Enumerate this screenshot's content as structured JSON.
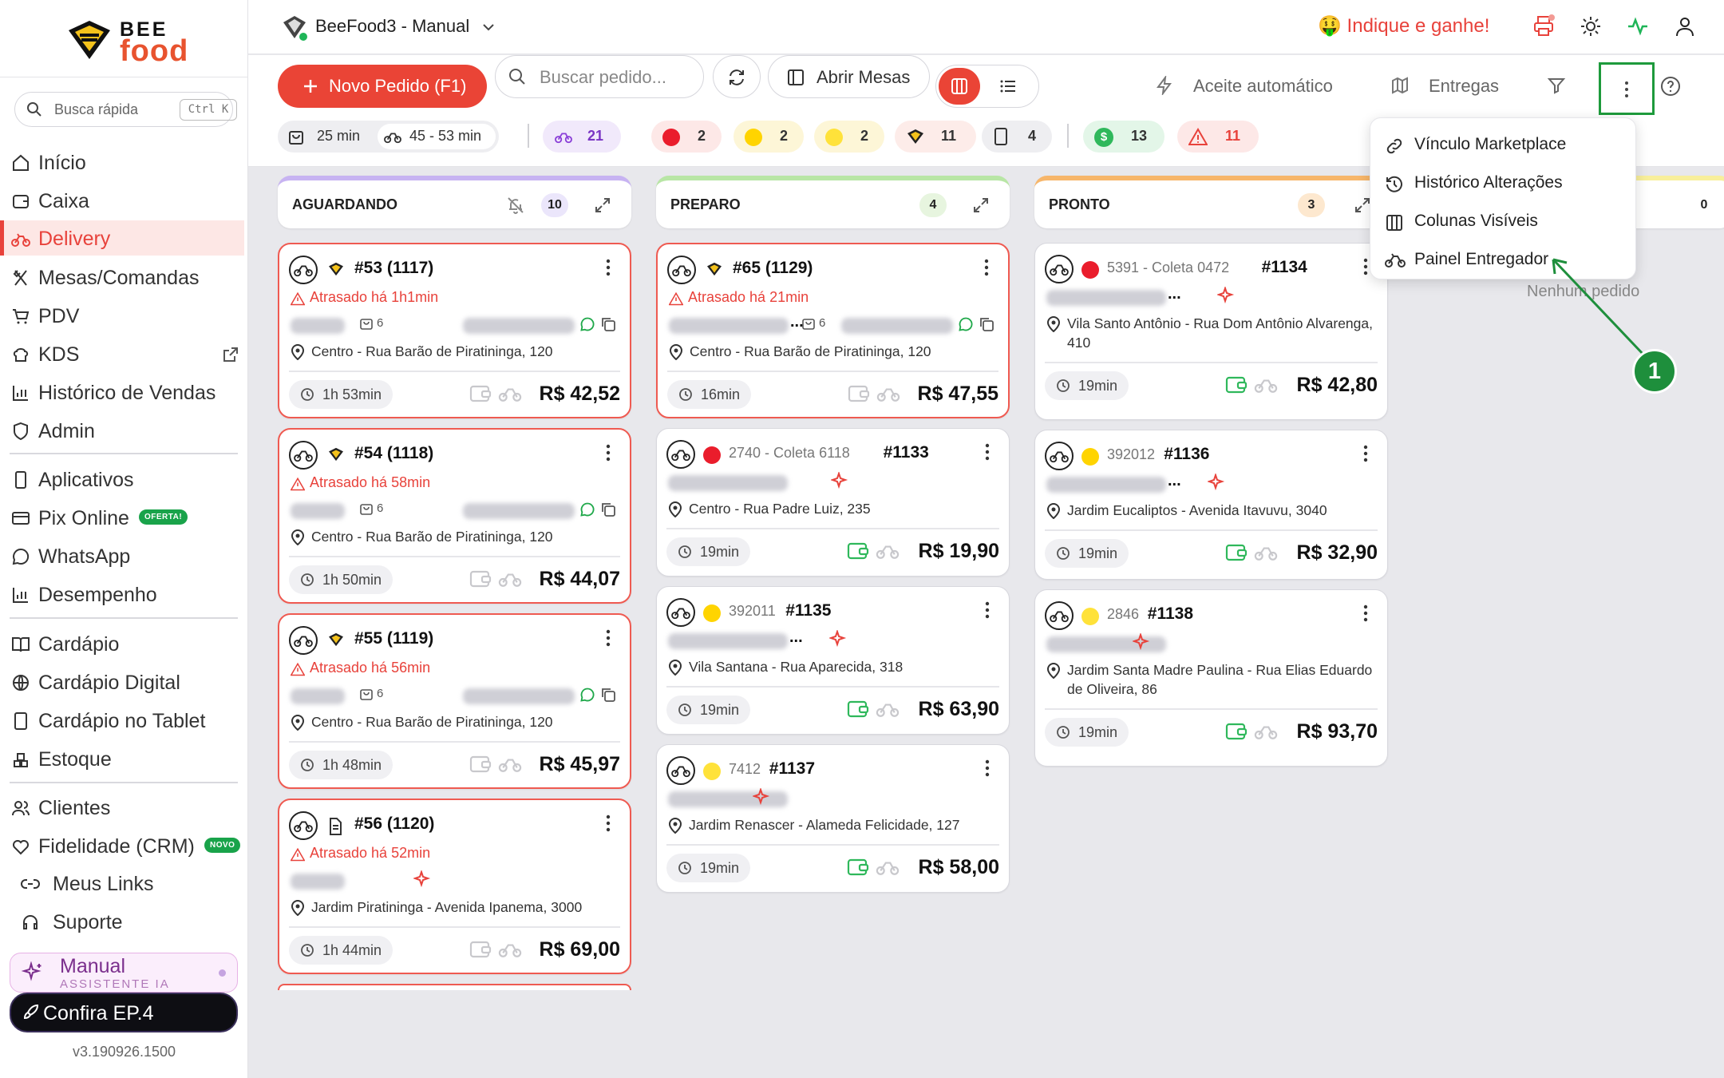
{
  "brand": {
    "line1": "BEE",
    "line2": "food"
  },
  "sidebar": {
    "search": {
      "label": "Busca rápida",
      "shortcut": "Ctrl K"
    },
    "items": [
      {
        "label": "Início"
      },
      {
        "label": "Caixa"
      },
      {
        "label": "Delivery",
        "active": true
      },
      {
        "label": "Mesas/Comandas"
      },
      {
        "label": "PDV"
      },
      {
        "label": "KDS"
      },
      {
        "label": "Histórico de Vendas"
      },
      {
        "label": "Admin"
      },
      {
        "label": "Aplicativos"
      },
      {
        "label": "Pix Online",
        "badge": "OFERTA!"
      },
      {
        "label": "WhatsApp"
      },
      {
        "label": "Desempenho"
      },
      {
        "label": "Cardápio"
      },
      {
        "label": "Cardápio Digital"
      },
      {
        "label": "Cardápio no Tablet"
      },
      {
        "label": "Estoque"
      },
      {
        "label": "Clientes"
      },
      {
        "label": "Fidelidade (CRM)",
        "badge": "NOVO"
      },
      {
        "label": "Meus Links"
      },
      {
        "label": "Suporte"
      }
    ],
    "manual": {
      "title": "Manual",
      "subtitle": "ASSISTENTE IA"
    },
    "cta": "Confira EP.4",
    "version": "v3.190926.1500"
  },
  "header": {
    "workspace": "BeeFood3 - Manual",
    "promo": "🤑 Indique e ganhe!"
  },
  "toolbar": {
    "new_order": "Novo Pedido (F1)",
    "search_placeholder": "Buscar pedido...",
    "open_tables": "Abrir Mesas",
    "auto_accept": "Aceite automático",
    "deliveries": "Entregas"
  },
  "chips": {
    "prep_time": "25 min",
    "delivery_time": "45 - 53 min",
    "bike": "21",
    "ifood": "2",
    "c99": "2",
    "keeta": "2",
    "beefood": "11",
    "tablet": "4",
    "money": "13",
    "alert": "11"
  },
  "columns": [
    {
      "title": "AGUARDANDO",
      "count": "10",
      "cards": [
        {
          "number": "#53 (1117)",
          "late": "Atrasado há 1h1min",
          "qty": "6",
          "address": "Centro - Rua Barão de Piratininga, 120",
          "time": "1h 53min",
          "price": "R$ 42,52"
        },
        {
          "number": "#54 (1118)",
          "late": "Atrasado há 58min",
          "qty": "6",
          "address": "Centro - Rua Barão de Piratininga, 120",
          "time": "1h 50min",
          "price": "R$ 44,07"
        },
        {
          "number": "#55 (1119)",
          "late": "Atrasado há 56min",
          "qty": "6",
          "address": "Centro - Rua Barão de Piratininga, 120",
          "time": "1h 48min",
          "price": "R$ 45,97"
        },
        {
          "number": "#56 (1120)",
          "late": "Atrasado há 52min",
          "address": "Jardim Piratininga - Avenida Ipanema, 3000",
          "time": "1h 44min",
          "price": "R$ 69,00"
        }
      ]
    },
    {
      "title": "PREPARO",
      "count": "4",
      "cards": [
        {
          "number": "#65 (1129)",
          "late": "Atrasado há 21min",
          "name_tail": "...",
          "qty": "6",
          "address": "Centro - Rua Barão de Piratininga, 120",
          "time": "16min",
          "price": "R$ 47,55"
        },
        {
          "coleta": "2740 - Coleta 6118",
          "number": "#1133",
          "address": "Centro - Rua Padre Luiz, 235",
          "time": "19min",
          "price": "R$ 19,90"
        },
        {
          "coleta": "392011",
          "number": "#1135",
          "name_tail": "...",
          "address": "Vila Santana - Rua Aparecida, 318",
          "time": "19min",
          "price": "R$ 63,90"
        },
        {
          "coleta": "7412",
          "number": "#1137",
          "address": "Jardim Renascer - Alameda Felicidade, 127",
          "time": "19min",
          "price": "R$ 58,00"
        }
      ]
    },
    {
      "title": "PRONTO",
      "count": "3",
      "cards": [
        {
          "coleta": "5391 - Coleta 0472",
          "number": "#1134",
          "name_tail": "...",
          "address": "Vila Santo Antônio - Rua Dom Antônio Alvarenga, 410",
          "time": "19min",
          "price": "R$ 42,80"
        },
        {
          "coleta": "392012",
          "number": "#1136",
          "name_tail": "...",
          "address": "Jardim Eucaliptos - Avenida Itavuvu, 3040",
          "time": "19min",
          "price": "R$ 32,90"
        },
        {
          "coleta": "2846",
          "number": "#1138",
          "address": "Jardim Santa Madre Paulina - Rua Elias Eduardo de Oliveira, 86",
          "time": "19min",
          "price": "R$ 93,70"
        }
      ]
    },
    {
      "title": "",
      "count": "0",
      "empty": "Nenhum pedido"
    }
  ],
  "menu": {
    "items": [
      "Vínculo Marketplace",
      "Histórico Alterações",
      "Colunas Visíveis",
      "Painel Entregador"
    ]
  },
  "annotation": "1",
  "colors": {
    "accent": "#ea4436",
    "green": "#1e8f3c",
    "purple": "#7b2f8d"
  }
}
